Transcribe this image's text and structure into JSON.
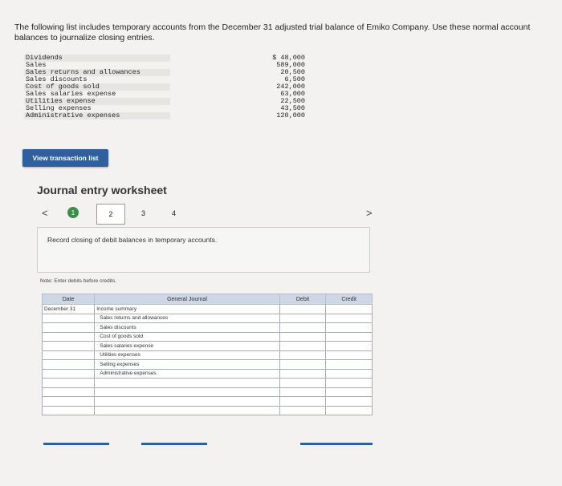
{
  "intro": "The following list includes temporary accounts from the December 31 adjusted trial balance of Emiko Company. Use these normal account balances to journalize closing entries.",
  "accounts": [
    {
      "name": "Dividends",
      "amount": "$ 48,000"
    },
    {
      "name": "Sales",
      "amount": "589,000"
    },
    {
      "name": "Sales returns and allowances",
      "amount": "20,500"
    },
    {
      "name": "Sales discounts",
      "amount": "6,500"
    },
    {
      "name": "Cost of goods sold",
      "amount": "242,000"
    },
    {
      "name": "Sales salaries expense",
      "amount": "63,000"
    },
    {
      "name": "Utilities expense",
      "amount": "22,500"
    },
    {
      "name": "Selling expenses",
      "amount": "43,500"
    },
    {
      "name": "Administrative expenses",
      "amount": "120,000"
    }
  ],
  "view_button": "View transaction list",
  "worksheet": {
    "title": "Journal entry worksheet",
    "prev": "<",
    "next": ">",
    "pages": [
      "1",
      "2",
      "3",
      "4"
    ],
    "instruction": "Record closing of debit balances in temporary accounts.",
    "note": "Note: Enter debits before credits."
  },
  "journal": {
    "headers": {
      "date": "Date",
      "journal": "General Journal",
      "debit": "Debit",
      "credit": "Credit"
    },
    "rows": [
      {
        "date": "December 31",
        "account": "Income summary",
        "indent": false
      },
      {
        "date": "",
        "account": "Sales returns and allowances",
        "indent": true
      },
      {
        "date": "",
        "account": "Sales discounts",
        "indent": true
      },
      {
        "date": "",
        "account": "Cost of goods sold",
        "indent": true
      },
      {
        "date": "",
        "account": "Sales salaries expense",
        "indent": true
      },
      {
        "date": "",
        "account": "Utilities expenses",
        "indent": true
      },
      {
        "date": "",
        "account": "Selling expenses",
        "indent": true
      },
      {
        "date": "",
        "account": "Administrative expenses",
        "indent": true
      },
      {
        "date": "",
        "account": "",
        "indent": true
      },
      {
        "date": "",
        "account": "",
        "indent": true
      },
      {
        "date": "",
        "account": "",
        "indent": true
      },
      {
        "date": "",
        "account": "",
        "indent": true
      }
    ]
  }
}
